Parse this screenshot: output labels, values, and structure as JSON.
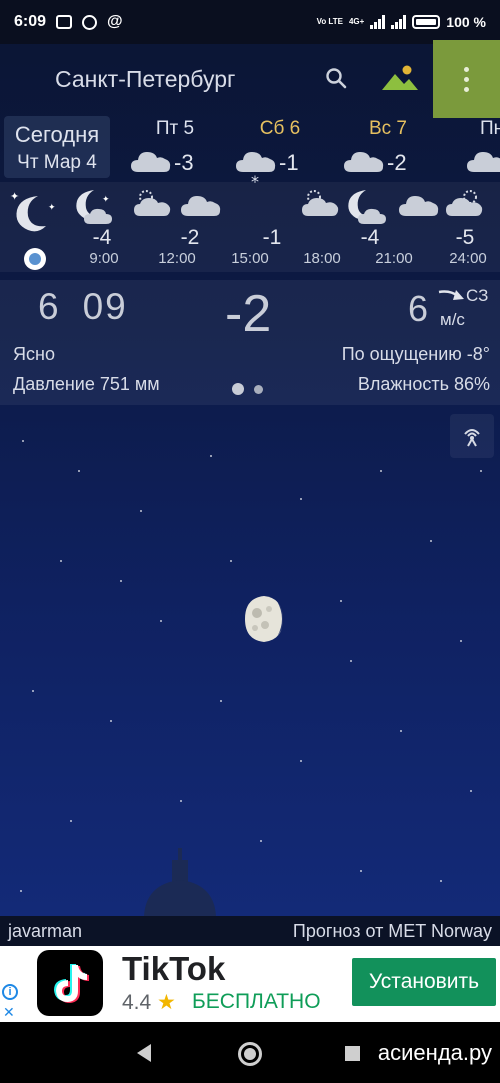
{
  "status_bar": {
    "time": "6:09",
    "network": "4G+",
    "volte": "Vo LTE",
    "battery": "100 %"
  },
  "header": {
    "city": "Санкт-Петербург"
  },
  "today": {
    "label": "Сегодня",
    "date": "Чт Мар 4"
  },
  "days": [
    {
      "name": "Пт 5",
      "temp": "-3",
      "icon": "cloud-icon",
      "color": "#dde2ee"
    },
    {
      "name": "Сб 6",
      "temp": "-1",
      "icon": "cloud-snow-icon",
      "color": "#e6c060"
    },
    {
      "name": "Вс 7",
      "temp": "-2",
      "icon": "cloud-icon",
      "color": "#e6c060"
    },
    {
      "name": "Пн",
      "temp": "",
      "icon": "cloud-icon",
      "color": "#dde2ee"
    }
  ],
  "hourly": [
    {
      "time": "9:00",
      "temp": "-4",
      "icon": "moon-cloud-icon"
    },
    {
      "time": "12:00",
      "temp": "-2",
      "icon": "partly-cloudy-icon"
    },
    {
      "time": "15:00",
      "temp": "-1",
      "icon": "cloud-icon"
    },
    {
      "time": "18:00",
      "temp": "-4",
      "icon": "partly-cloudy-icon"
    },
    {
      "time": "21:00",
      "temp": "-5",
      "icon": "cloud-icon"
    },
    {
      "time": "24:00",
      "temp": "",
      "icon": "cloud-icon"
    }
  ],
  "current": {
    "hour": "6",
    "minute": "09",
    "temp": "-2",
    "wind_speed": "6",
    "wind_dir": "СЗ",
    "wind_unit": "м/с",
    "condition": "Ясно",
    "feels_like": "По ощущению -8°",
    "pressure": "Давление 751 мм",
    "humidity": "Влажность 86%"
  },
  "footer": {
    "author": "javarman",
    "source": "Прогноз от MET Norway"
  },
  "ad": {
    "app": "TikTok",
    "rating": "4.4",
    "price": "БЕСПЛАТНО",
    "button": "Установить",
    "info_icon": "i",
    "close_icon": "✕"
  },
  "watermark": "асиенда.ру",
  "colors": {
    "menu_bg": "#7b9a3c",
    "gold_day": "#e6c060",
    "install_green": "#12915b"
  }
}
